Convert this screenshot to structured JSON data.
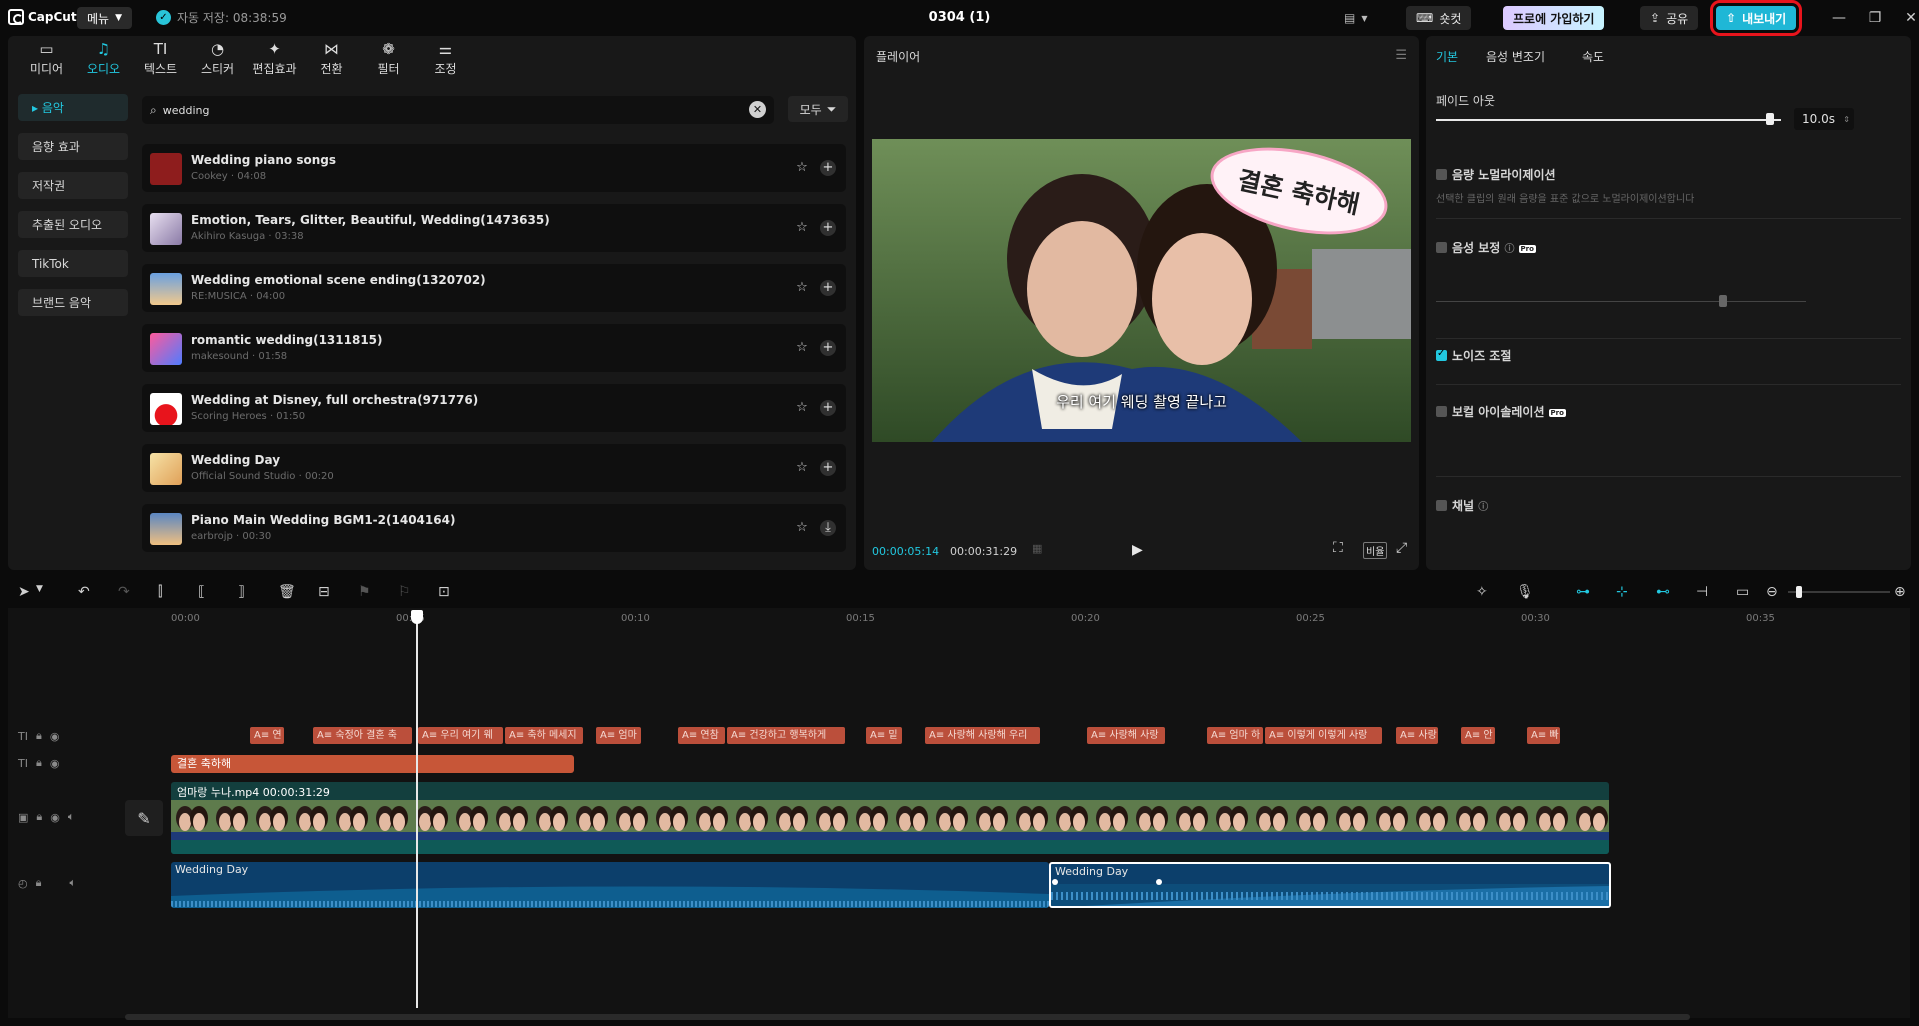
{
  "titlebar": {
    "app_name": "CapCut",
    "menu_label": "메뉴",
    "autosave": "자동 저장: 08:38:59",
    "project_title": "0304 (1)",
    "shortcut_label": "숏컷",
    "pro_label": "프로에 가입하기",
    "share_label": "공유",
    "export_label": "내보내기"
  },
  "left_tabs": [
    {
      "icon": "media-icon",
      "glyph": "▭",
      "label": "미디어"
    },
    {
      "icon": "audio-icon",
      "glyph": "♫",
      "label": "오디오"
    },
    {
      "icon": "text-icon",
      "glyph": "TI",
      "label": "텍스트"
    },
    {
      "icon": "sticker-icon",
      "glyph": "◔",
      "label": "스티커"
    },
    {
      "icon": "effects-icon",
      "glyph": "✦",
      "label": "편집효과"
    },
    {
      "icon": "transition-icon",
      "glyph": "⋈",
      "label": "전환"
    },
    {
      "icon": "filter-icon",
      "glyph": "❁",
      "label": "필터"
    },
    {
      "icon": "adjust-icon",
      "glyph": "⚌",
      "label": "조정"
    }
  ],
  "categories": [
    "음악",
    "음향 효과",
    "저작권",
    "추출된 오디오",
    "TikTok",
    "브랜드 음악"
  ],
  "search": {
    "value": "wedding",
    "filter_label": "모두"
  },
  "tracks": [
    {
      "title": "Wedding piano songs",
      "sub": "Cookey · 04:08",
      "color": "#8e1d1d"
    },
    {
      "title": "Emotion, Tears, Glitter, Beautiful, Wedding(1473635)",
      "sub": "Akihiro Kasuga · 03:38",
      "color": "#c9b8d8"
    },
    {
      "title": "Wedding emotional scene ending(1320702)",
      "sub": "RE:MUSICA · 04:00",
      "color": "#4d7fc0"
    },
    {
      "title": "romantic wedding(1311815)",
      "sub": "makesound · 01:58",
      "color": "#e84a8a"
    },
    {
      "title": "Wedding at Disney, full orchestra(971776)",
      "sub": "Scoring Heroes · 01:50",
      "color": "#ffffff"
    },
    {
      "title": "Wedding Day",
      "sub": "Official Sound Studio · 00:20",
      "color": "#f3d38a"
    },
    {
      "title": "Piano Main Wedding BGM1-2(1404164)",
      "sub": "earbrojp · 00:30",
      "color": "#5a86c2"
    }
  ],
  "player": {
    "title": "플레이어",
    "subtitle": "우리 여기 웨딩 촬영 끝나고",
    "sticker": "결혼 축하해",
    "time_current": "00:00:05:14",
    "time_total": "00:00:31:29",
    "ratio_label": "비율"
  },
  "props": {
    "tabs": [
      "기본",
      "음성 변조기",
      "속도"
    ],
    "fade_out_label": "페이드 아웃",
    "fade_out_value": "10.0s",
    "fade_out_level": 0.98,
    "normalize_label": "음량 노멀라이제이션",
    "normalize_desc": "선택한 클립의 원래 음량을 표준 값으로 노멀라이제이션합니다",
    "enhance_label": "음성 보정",
    "noise_label": "노이즈 조절",
    "vocal_label": "보컬 아이솔레이션",
    "channel_label": "채널",
    "pro_badge": "Pro"
  },
  "timeline": {
    "ruler": [
      "00:00",
      "00:05",
      "00:10",
      "00:15",
      "00:20",
      "00:25",
      "00:30",
      "00:35"
    ],
    "text_clips": [
      "연",
      "숙정아 결혼 축",
      "우리 여기 웨",
      "축하 메세지",
      "엄마",
      "연참",
      "건강하고 행복하게",
      "밑",
      "사랑해 사랑해 우리",
      "사랑해 사랑",
      "엄마 하",
      "이렇게 이렇게 사랑",
      "사랑",
      "안",
      "빠"
    ],
    "title_clip": "결혼 축하해",
    "video_clip": "엄마랑 누나.mp4  00:00:31:29",
    "audio_clip_1": "Wedding Day",
    "audio_clip_2": "Wedding Day"
  }
}
